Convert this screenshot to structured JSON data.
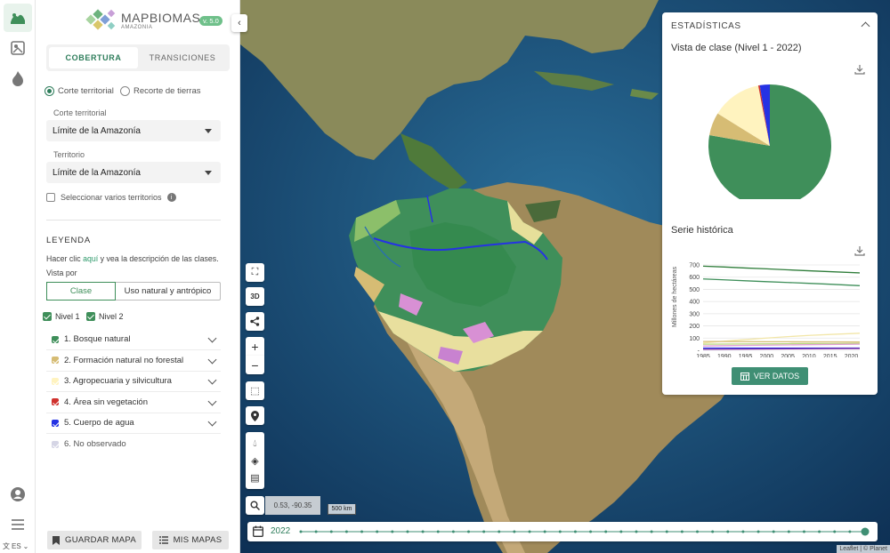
{
  "logo": {
    "title": "MAPBIOMAS",
    "subtitle": "AMAZONIA",
    "version": "v. 5.0"
  },
  "tabs": {
    "cobertura": "COBERTURA",
    "transiciones": "TRANSICIONES"
  },
  "mode": {
    "option1": "Corte territorial",
    "option2": "Recorte de tierras",
    "selected": "Corte territorial"
  },
  "fields": {
    "corte_label": "Corte territorial",
    "corte_value": "Límite de la Amazonía",
    "territorio_label": "Territorio",
    "territorio_value": "Límite de la Amazonía",
    "multi_label": "Seleccionar varios territorios"
  },
  "legend": {
    "heading": "LEYENDA",
    "hint_prefix": "Hacer clic",
    "hint_link": "aquí",
    "hint_suffix": "y vea la descripción de las clases.",
    "view_by": "Vista por",
    "view_class": "Clase",
    "view_use": "Uso natural y antrópico",
    "level1": "Nivel 1",
    "level2": "Nivel 2",
    "items": [
      {
        "label": "1. Bosque natural",
        "color": "#3f8f5a",
        "checked": true
      },
      {
        "label": "2. Formación natural no forestal",
        "color": "#d6bc74",
        "checked": true
      },
      {
        "label": "3. Agropecuaria y silvicultura",
        "color": "#fff3bf",
        "checked": true
      },
      {
        "label": "4. Área sin vegetación",
        "color": "#d0312d",
        "checked": true
      },
      {
        "label": "5. Cuerpo de agua",
        "color": "#2532e4",
        "checked": true
      },
      {
        "label": "6. No observado",
        "color": "#d5d5e5",
        "checked": true
      }
    ]
  },
  "bottom": {
    "save": "GUARDAR MAPA",
    "maps": "MIS MAPAS",
    "lang": "ES"
  },
  "map": {
    "coords": "0.53, -90.35",
    "scale": "500 km",
    "attribution": "Leaflet | © Planet",
    "year": "2022",
    "ctl_3d": "3D"
  },
  "stats": {
    "heading": "ESTADÍSTICAS",
    "pie_title": "Vista de clase (Nivel 1 - 2022)",
    "series_title": "Serie histórica",
    "ylabel": "Millones de hectáreas",
    "button": "VER DATOS"
  },
  "chart_data": [
    {
      "type": "pie",
      "title": "Vista de clase (Nivel 1 - 2022)",
      "categories": [
        "1. Bosque natural",
        "2. Formación natural no forestal",
        "3. Agropecuaria y silvicultura",
        "4. Área sin vegetación",
        "5. Cuerpo de agua"
      ],
      "values": [
        77,
        6,
        13,
        0.4,
        2.6
      ],
      "colors": [
        "#3f8f5a",
        "#d6bc74",
        "#fff3bf",
        "#d0312d",
        "#2532e4"
      ]
    },
    {
      "type": "line",
      "title": "Serie histórica",
      "ylabel": "Millones de hectáreas",
      "x": [
        1985,
        1990,
        1995,
        2000,
        2005,
        2010,
        2015,
        2022
      ],
      "xticks": [
        1985,
        1990,
        1995,
        2000,
        2005,
        2010,
        2015,
        2020
      ],
      "yticks": [
        0,
        100,
        200,
        300,
        400,
        500,
        600,
        700
      ],
      "ylim": [
        0,
        700
      ],
      "series": [
        {
          "color": "#2f7d3a",
          "values": [
            690,
            683,
            675,
            668,
            660,
            652,
            645,
            635
          ]
        },
        {
          "color": "#3f8f5a",
          "values": [
            585,
            578,
            570,
            563,
            556,
            549,
            542,
            530
          ]
        },
        {
          "color": "#f2e6a8",
          "values": [
            60,
            75,
            88,
            100,
            112,
            122,
            130,
            140
          ]
        },
        {
          "color": "#d6bc74",
          "values": [
            72,
            72,
            71,
            70,
            70,
            69,
            69,
            68
          ]
        },
        {
          "color": "#b7d67a",
          "values": [
            50,
            51,
            52,
            53,
            54,
            55,
            55,
            56
          ]
        },
        {
          "color": "#e3a0d6",
          "values": [
            35,
            38,
            40,
            42,
            44,
            46,
            48,
            50
          ]
        },
        {
          "color": "#2532e4",
          "values": [
            18,
            18,
            18,
            18,
            18,
            18,
            18,
            18
          ]
        },
        {
          "color": "#7a2ca3",
          "values": [
            8,
            9,
            10,
            11,
            12,
            13,
            14,
            15
          ]
        }
      ]
    }
  ]
}
